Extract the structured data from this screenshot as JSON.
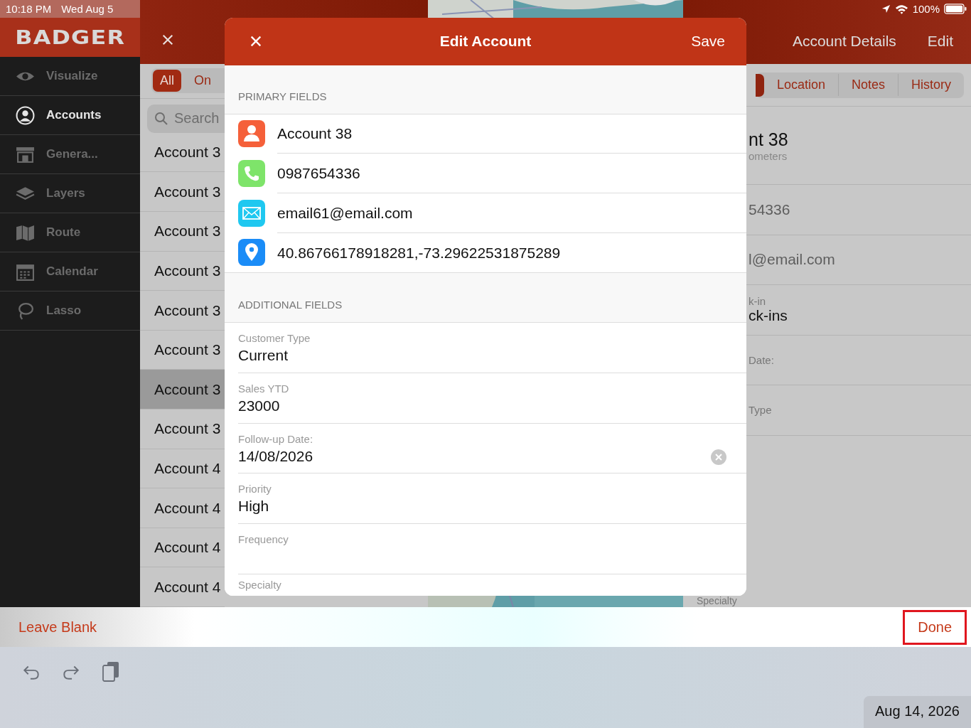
{
  "status_bar": {
    "time": "10:18 PM",
    "date": "Wed Aug 5",
    "battery": "100%"
  },
  "sidebar": {
    "logo": "BADGER",
    "items": [
      {
        "label": "Visualize",
        "selected": false
      },
      {
        "label": "Accounts",
        "selected": true
      },
      {
        "label": "Genera...",
        "selected": false
      },
      {
        "label": "Layers",
        "selected": false
      },
      {
        "label": "Route",
        "selected": false
      },
      {
        "label": "Calendar",
        "selected": false
      },
      {
        "label": "Lasso",
        "selected": false
      }
    ]
  },
  "list_pane": {
    "filters": [
      {
        "label": "All",
        "selected": true
      },
      {
        "label": "On",
        "selected": false
      }
    ],
    "search": {
      "placeholder": "Search"
    },
    "rows": [
      {
        "label": "Account 3",
        "selected": false
      },
      {
        "label": "Account 3",
        "selected": false
      },
      {
        "label": "Account 3",
        "selected": false
      },
      {
        "label": "Account 3",
        "selected": false
      },
      {
        "label": "Account 3",
        "selected": false
      },
      {
        "label": "Account 3",
        "selected": false
      },
      {
        "label": "Account 3",
        "selected": true
      },
      {
        "label": "Account 3",
        "selected": false
      },
      {
        "label": "Account 4",
        "selected": false
      },
      {
        "label": "Account 4",
        "selected": false
      },
      {
        "label": "Account 4",
        "selected": false
      },
      {
        "label": "Account 4",
        "selected": false
      }
    ]
  },
  "detail": {
    "title": "Account Details",
    "edit": "Edit",
    "tabs": [
      {
        "selected": true
      },
      {
        "label": "Location",
        "selected": false
      },
      {
        "label": "Notes",
        "selected": false
      },
      {
        "label": "History",
        "selected": false
      }
    ],
    "fields": [
      {
        "value": "nt 38",
        "sub": "ometers"
      },
      {
        "value": "54336",
        "muted": true
      },
      {
        "value": "l@email.com",
        "muted": true
      },
      {
        "label": "k-in",
        "value": "ck-ins"
      },
      {
        "label": "Date:"
      },
      {
        "label": "Type"
      },
      {
        "label": "Specialty"
      }
    ]
  },
  "modal": {
    "title": "Edit Account",
    "save": "Save",
    "primary_header": "PRIMARY FIELDS",
    "primary": [
      {
        "kind": "contact",
        "value": "Account 38"
      },
      {
        "kind": "phone",
        "value": "0987654336"
      },
      {
        "kind": "email",
        "value": "email61@email.com"
      },
      {
        "kind": "location",
        "value": "40.86766178918281,-73.29622531875289"
      }
    ],
    "additional_header": "ADDITIONAL FIELDS",
    "additional": [
      {
        "label": "Customer Type",
        "value": "Current"
      },
      {
        "label": "Sales YTD",
        "value": "23000"
      },
      {
        "label": "Follow-up Date:",
        "value": "14/08/2026",
        "clearable": true
      },
      {
        "label": "Priority",
        "value": "High"
      },
      {
        "label": "Frequency"
      },
      {
        "label": "Specialty"
      }
    ]
  },
  "accessory": {
    "leave_blank": "Leave Blank",
    "done": "Done"
  },
  "toolbar": {
    "date": "Aug 14, 2026"
  }
}
